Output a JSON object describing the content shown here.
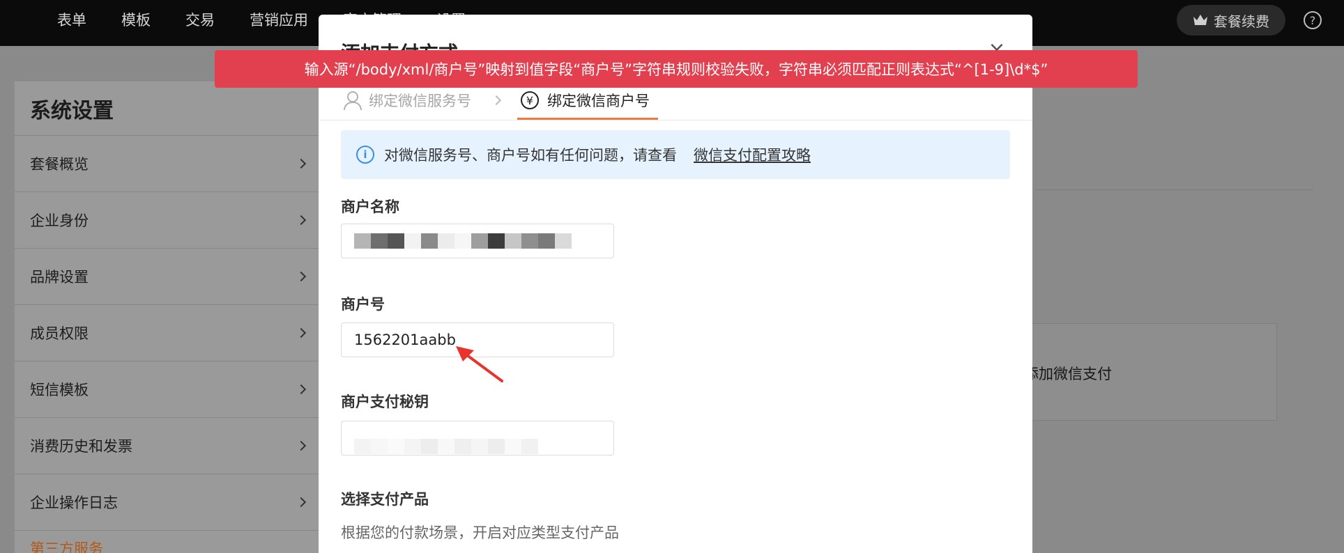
{
  "topnav": {
    "items": [
      "表单",
      "模板",
      "交易",
      "营销应用",
      "客户管理",
      "设置"
    ],
    "renew_label": "套餐续费",
    "help_label": "?"
  },
  "sidebar": {
    "title": "系统设置",
    "items": [
      {
        "label": "套餐概览"
      },
      {
        "label": "企业身份"
      },
      {
        "label": "品牌设置"
      },
      {
        "label": "成员权限"
      },
      {
        "label": "短信模板"
      },
      {
        "label": "消费历史和发票"
      },
      {
        "label": "企业操作日志"
      },
      {
        "label": "第三方服务"
      }
    ]
  },
  "background": {
    "card_text": "添加微信支付"
  },
  "modal": {
    "title": "添加支付方式",
    "close": "×",
    "steps": [
      {
        "label": "绑定微信服务号",
        "icon": "person-icon",
        "state": "done"
      },
      {
        "label": "绑定微信商户号",
        "icon": "yuan-icon",
        "state": "active"
      }
    ],
    "info": {
      "text": "对微信服务号、商户号如有任何问题，请查看",
      "link": "微信支付配置攻略"
    },
    "fields": {
      "merchant_name_label": "商户名称",
      "merchant_id_label": "商户号",
      "merchant_id_value": "1562201aabb",
      "merchant_secret_label": "商户支付秘钥"
    },
    "product": {
      "label": "选择支付产品",
      "hint": "根据您的付款场景，开启对应类型支付产品"
    }
  },
  "toast": {
    "message": "输入源“/body/xml/商户号”映射到值字段“商户号”字符串规则校验失败，字符串必须匹配正则表达式“^[1-9]\\d*$”"
  },
  "colors": {
    "toast_bg": "#e3404f",
    "accent": "#f07a3c",
    "info_bg": "#e6f3ff",
    "info_icon": "#3a8ee6"
  }
}
